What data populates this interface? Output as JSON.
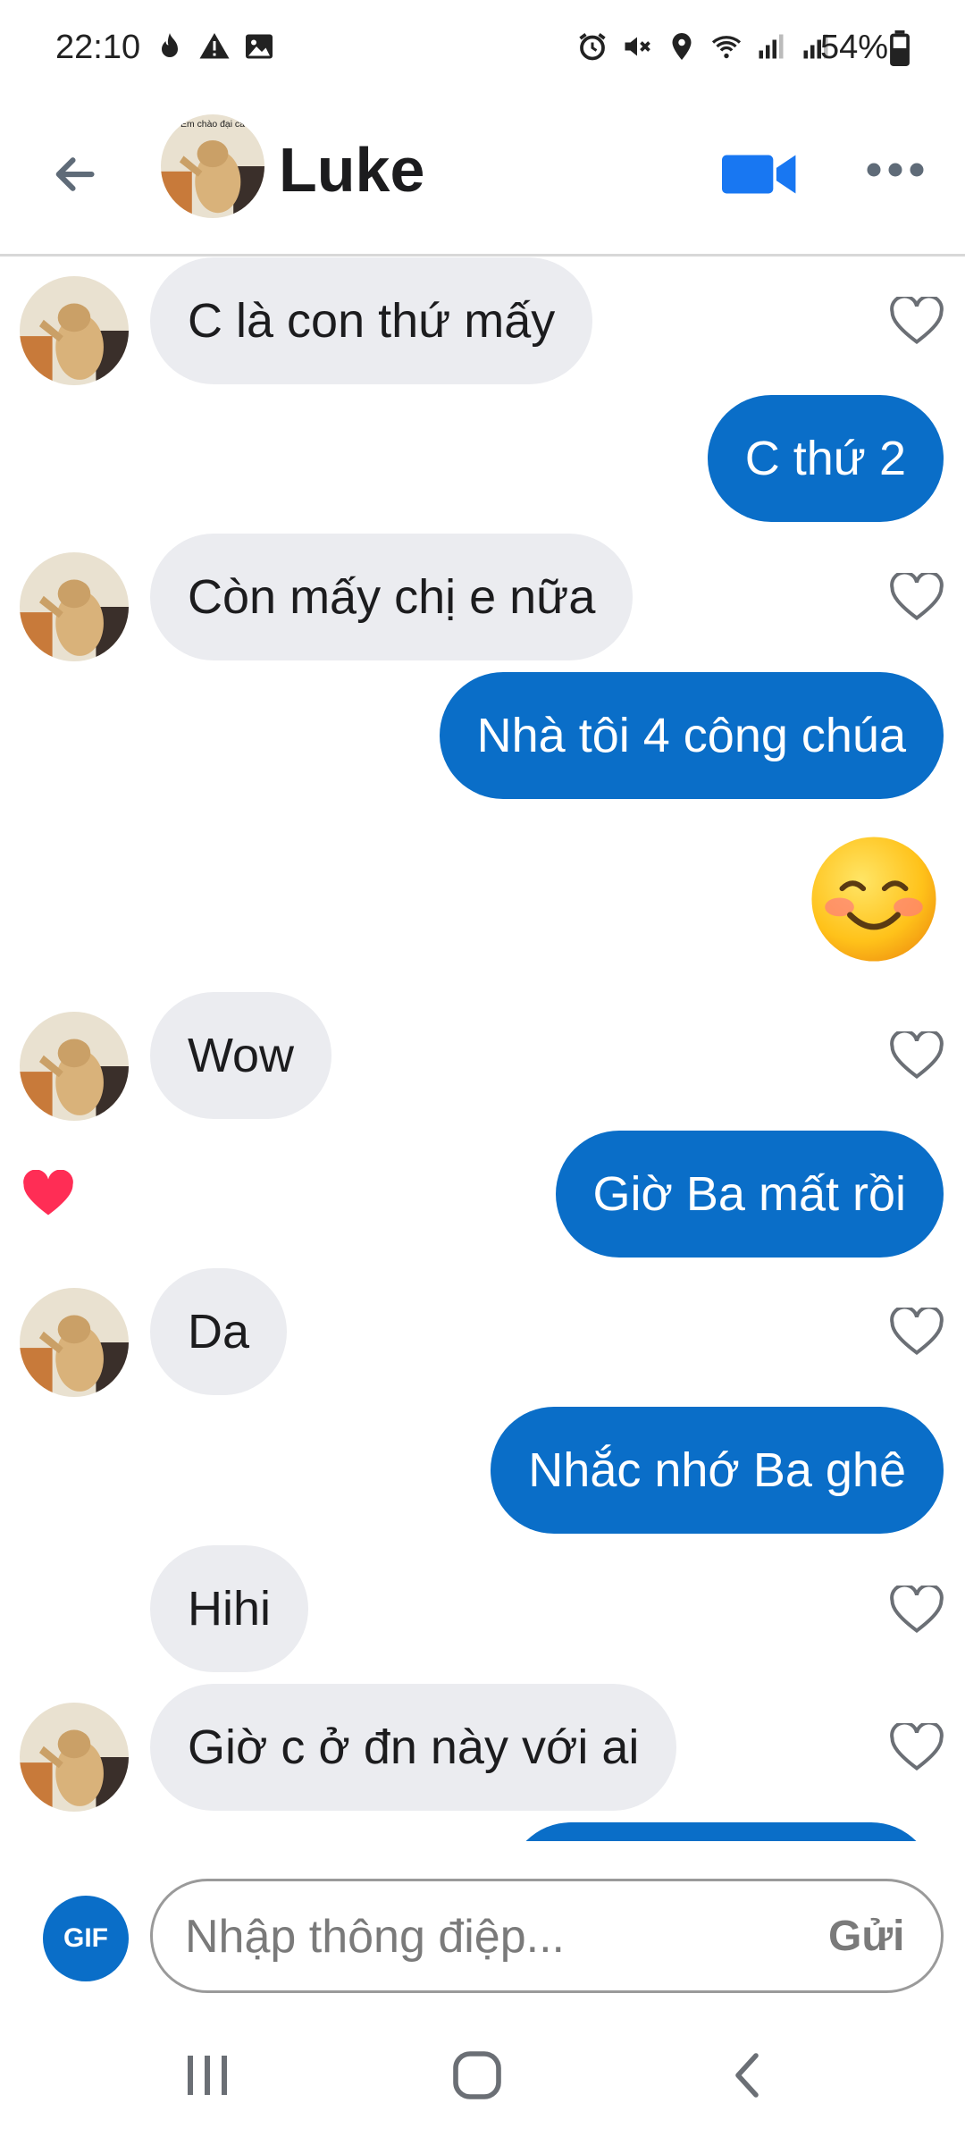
{
  "status_bar": {
    "time": "22:10",
    "battery": "54%"
  },
  "header": {
    "contact_name": "Luke",
    "back_icon": "arrow-left-icon",
    "video_icon": "video-camera-icon",
    "more_icon": "more-horizontal-icon",
    "avatar_caption": "Em chào đại ca"
  },
  "messages": [
    {
      "dir": "in",
      "text": "C là con thứ mấy",
      "avatar": true,
      "like": "empty"
    },
    {
      "dir": "out",
      "text": "C thứ 2"
    },
    {
      "dir": "in",
      "text": "Còn mấy chị e nữa",
      "avatar": true,
      "like": "empty"
    },
    {
      "dir": "out",
      "text": "Nhà tôi 4 công chúa"
    },
    {
      "dir": "out",
      "emoji": "smiling-blushing-face-emoji"
    },
    {
      "dir": "in",
      "text": "Wow",
      "avatar": true,
      "like": "empty"
    },
    {
      "dir": "out",
      "text": "Giờ Ba mất rồi",
      "liked": true
    },
    {
      "dir": "in",
      "text": "Da",
      "avatar": true,
      "like": "empty"
    },
    {
      "dir": "out",
      "text": "Nhắc nhớ Ba ghê"
    },
    {
      "dir": "in",
      "text": "Hihi",
      "avatar": false,
      "like": "empty"
    },
    {
      "dir": "in",
      "text": "Giờ c ở đn này với ai",
      "avatar": true,
      "like": "empty"
    }
  ],
  "composer": {
    "gif_label": "GIF",
    "placeholder": "Nhập thông điệp...",
    "send_label": "Gửi"
  },
  "colors": {
    "outgoing_bubble": "#0a6ec8",
    "incoming_bubble": "#ebecf0",
    "like_heart": "#ff2d55",
    "video_icon": "#1877f2"
  }
}
